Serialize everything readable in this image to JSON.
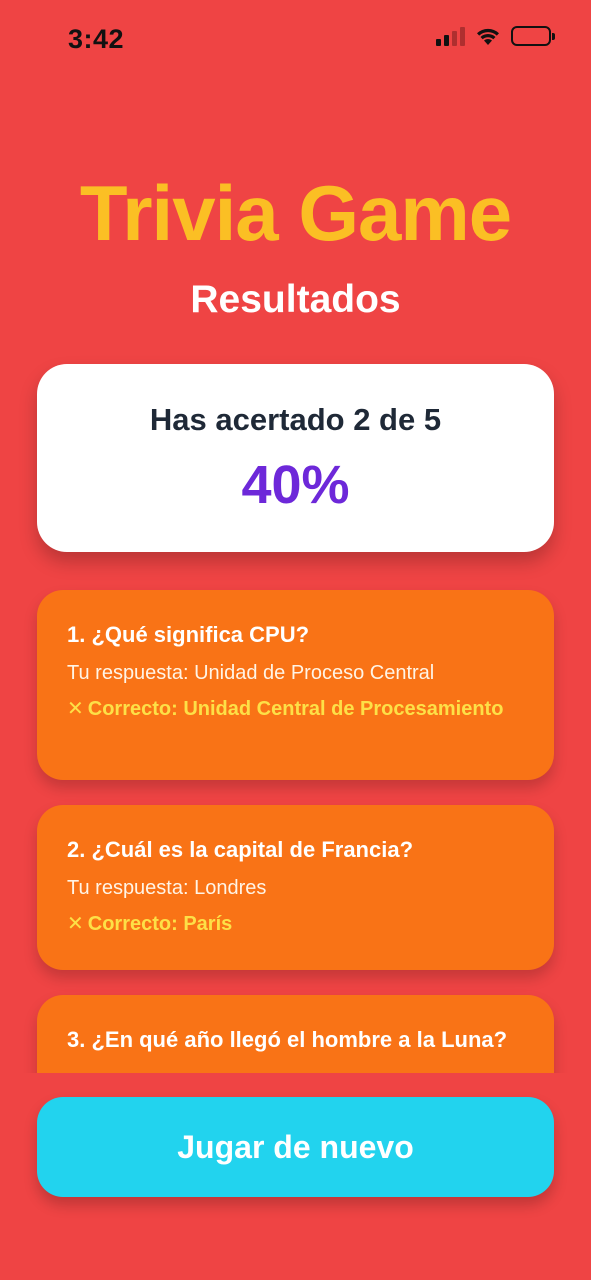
{
  "status_bar": {
    "time": "3:42",
    "signal_icon": "cellular-signal-icon",
    "wifi_icon": "wifi-icon",
    "battery_icon": "battery-icon",
    "battery_level": 0.2,
    "battery_color": "#EF4444"
  },
  "header": {
    "title": "Trivia Game",
    "subtitle": "Resultados"
  },
  "score": {
    "text": "Has acertado 2 de 5",
    "percent": "40%"
  },
  "results": [
    {
      "question": "1. ¿Qué significa CPU?",
      "answer": "Tu respuesta: Unidad de Proceso Central",
      "correct_mark": "✕",
      "correct": "Correcto: Unidad Central de Procesamiento"
    },
    {
      "question": "2. ¿Cuál es la capital de Francia?",
      "answer": "Tu respuesta: Londres",
      "correct_mark": "✕",
      "correct": "Correcto: París"
    },
    {
      "question": "3. ¿En qué año llegó el hombre a la Luna?"
    }
  ],
  "actions": {
    "play_again_label": "Jugar de nuevo"
  },
  "colors": {
    "background": "#EF4444",
    "title": "#FBBF24",
    "card": "#F97316",
    "accent_percent": "#6D28D9",
    "button": "#22D3EE",
    "correct_text": "#FDE047"
  }
}
